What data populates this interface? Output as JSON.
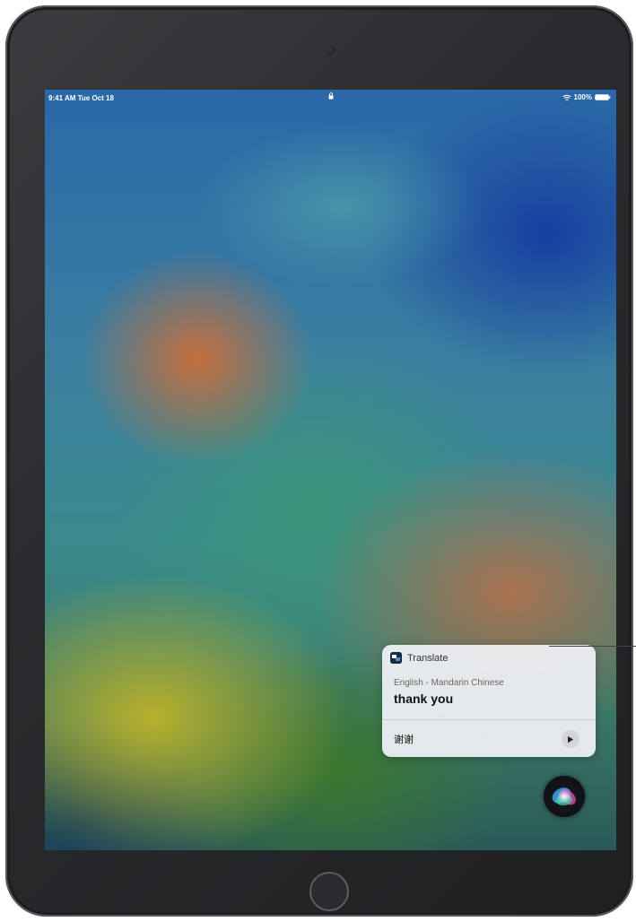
{
  "status_bar": {
    "time": "9:41 AM  Tue Oct 18",
    "battery": "100%"
  },
  "siri_card": {
    "app_name": "Translate",
    "language_pair": "English - Mandarin Chinese",
    "source_text": "thank you",
    "translated_text": "谢谢"
  },
  "icons": {
    "lock": "lock-icon",
    "wifi": "wifi-icon",
    "battery": "battery-icon",
    "translate_app": "translate-app-icon",
    "play": "play-icon",
    "siri": "siri-icon"
  }
}
